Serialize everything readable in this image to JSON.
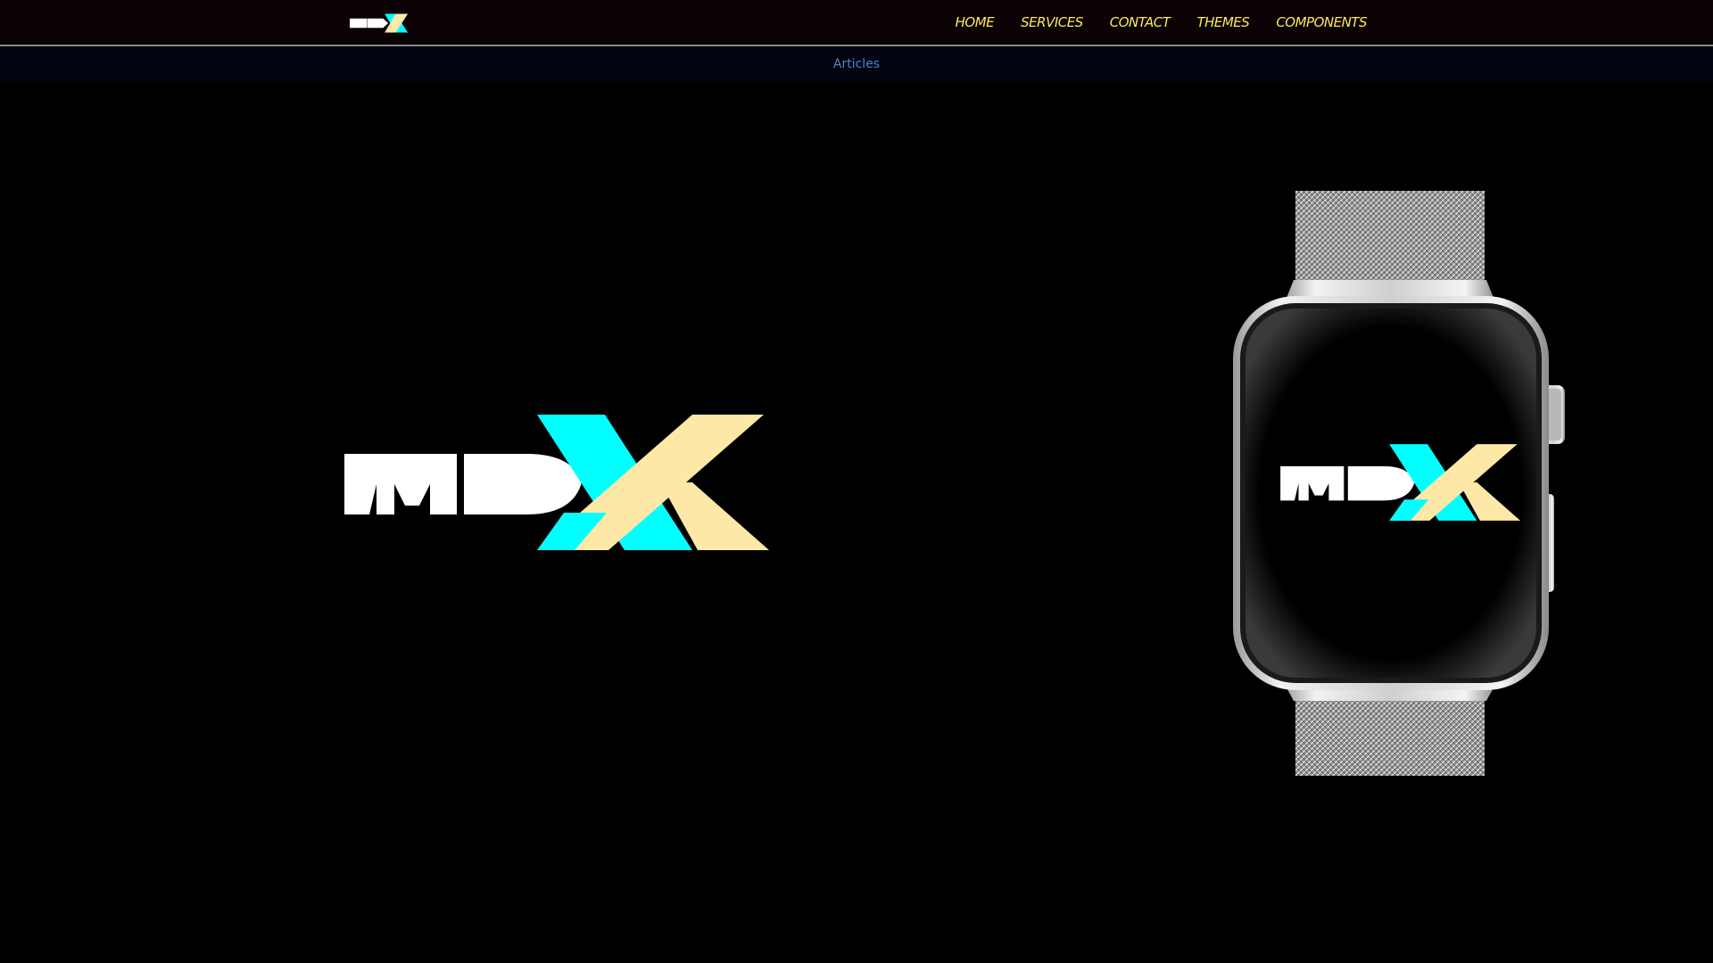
{
  "nav": {
    "logo_name": "mdx-logo",
    "links": [
      "HOME",
      "SERVICES",
      "CONTACT",
      "THEMES",
      "COMPONENTS"
    ]
  },
  "subnav": {
    "articles_label": "Articles"
  },
  "hero": {
    "logo_name": "mdx-logo",
    "device_name": "smartwatch"
  },
  "colors": {
    "nav_link": "#ffe85c",
    "sub_link": "#4a86c8",
    "logo_white": "#ffffff",
    "logo_cyan": "#00ffff",
    "logo_cream": "#fde8a8"
  }
}
